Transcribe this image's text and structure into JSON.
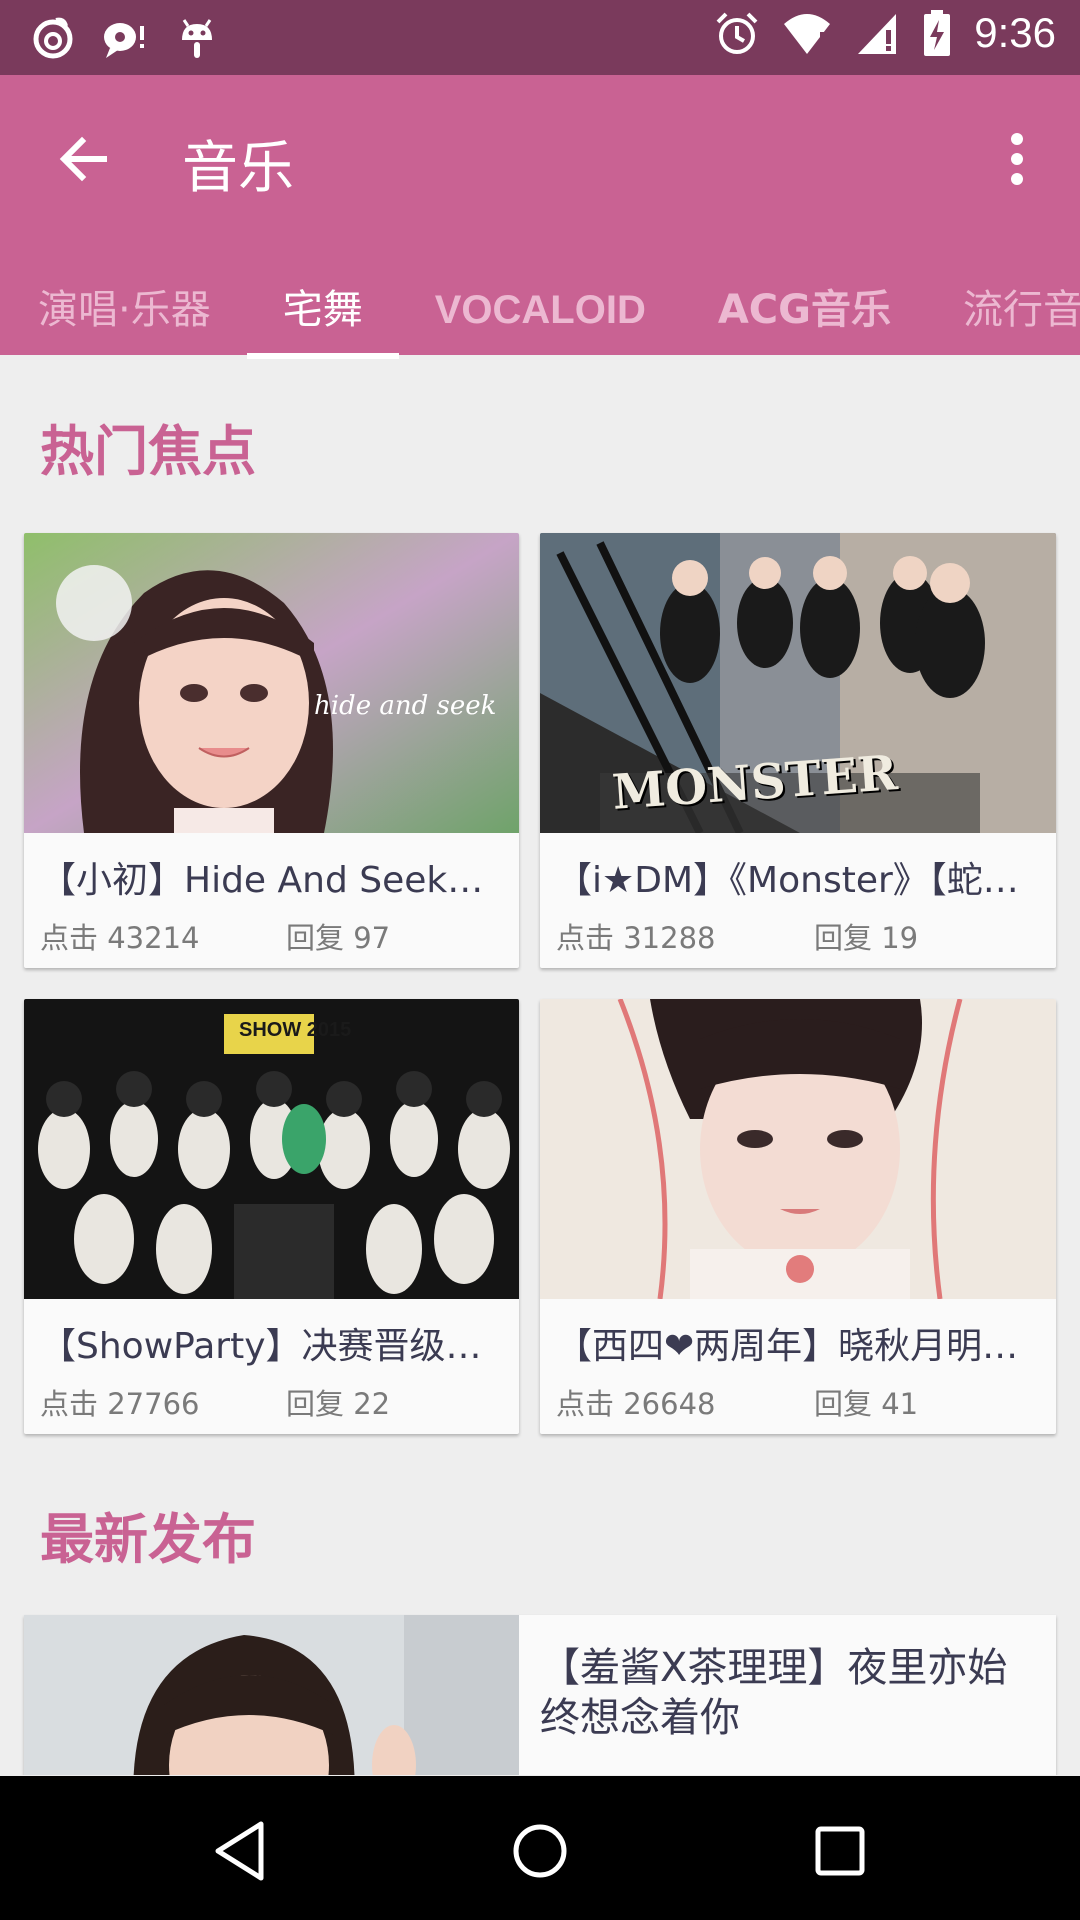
{
  "status_bar": {
    "time": "9:36",
    "left_icons": [
      "netease-music-icon",
      "chat-notification-icon",
      "android-icon"
    ],
    "right_icons": [
      "alarm-icon",
      "wifi-icon",
      "signal-icon",
      "battery-charging-icon"
    ]
  },
  "app_bar": {
    "title": "音乐",
    "back_icon": "arrow-back-icon",
    "menu_icon": "more-vert-icon",
    "background": "#c96293"
  },
  "tabs": [
    {
      "label": "演唱·乐器",
      "active": false
    },
    {
      "label": "宅舞",
      "active": true
    },
    {
      "label": "VOCALOID",
      "active": false
    },
    {
      "label": "ACG音乐",
      "active": false
    },
    {
      "label": "流行音乐",
      "active": false
    }
  ],
  "hot_section": {
    "title": "热门焦点",
    "cards": [
      {
        "title": "【小初】Hide And Seek☆…",
        "clicks": "点击 43214",
        "replies": "回复 97",
        "overlay": "hide and seek"
      },
      {
        "title": "【i★DM】《Monster》【蛇…",
        "clicks": "点击 31288",
        "replies": "回复 19",
        "overlay": "MONSTER"
      },
      {
        "title": "【ShowParty】决赛晋级选…",
        "clicks": "点击 27766",
        "replies": "回复 22",
        "overlay": "SHOW 2015"
      },
      {
        "title": "【西四❤两周年】晓秋月明…",
        "clicks": "点击 26648",
        "replies": "回复 41",
        "overlay": ""
      }
    ]
  },
  "latest_section": {
    "title": "最新发布",
    "items": [
      {
        "title": "【羞酱X茶理理】夜里亦始终想念着你"
      }
    ]
  },
  "nav_bar": {
    "icons": [
      "nav-back-icon",
      "nav-home-icon",
      "nav-recents-icon"
    ]
  }
}
